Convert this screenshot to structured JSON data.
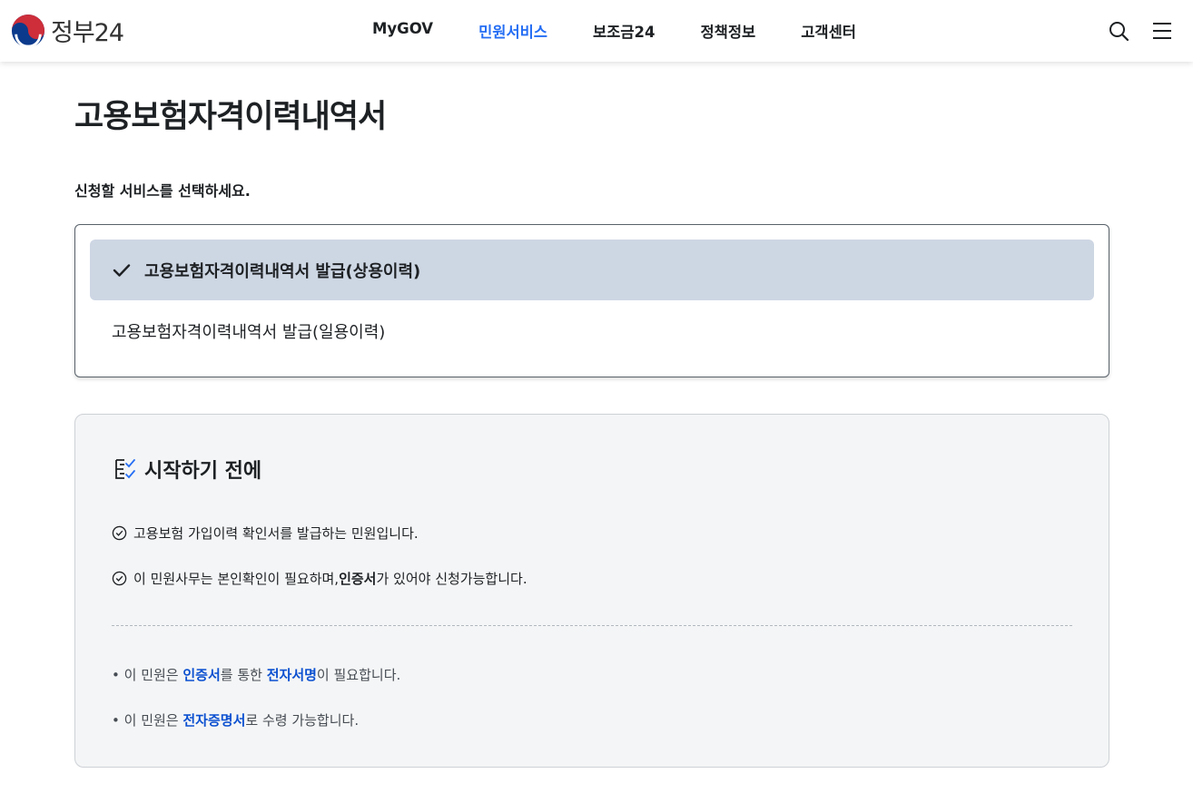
{
  "header": {
    "logo_text": "정부24",
    "nav": [
      "MyGOV",
      "민원서비스",
      "보조금24",
      "정책정보",
      "고객센터"
    ],
    "active_nav": "민원서비스"
  },
  "page": {
    "title": "고용보험자격이력내역서",
    "select_prompt": "신청할 서비스를 선택하세요."
  },
  "services": {
    "selected": "고용보험자격이력내역서 발급(상용이력)",
    "other": "고용보험자격이력내역서 발급(일용이력)"
  },
  "before_start": {
    "title": "시작하기 전에",
    "line1": "고용보험 가입이력 확인서를 발급하는 민원입니다.",
    "line2_pre": "이 민원사무는 본인확인이 필요하며, ",
    "line2_bold": "인증서",
    "line2_post": "가 있어야 신청가능합니다.",
    "note1_pre": "이 민원은 ",
    "note1_hl1": "인증서",
    "note1_mid": "를 통한 ",
    "note1_hl2": "전자서명",
    "note1_post": "이 필요합니다.",
    "note2_pre": "이 민원은 ",
    "note2_hl": "전자증명서",
    "note2_post": "로 수령 가능합니다."
  },
  "colors": {
    "accent": "#256ef4",
    "selected_bg": "#cdd6e3",
    "highlight": "#0b50d0"
  }
}
